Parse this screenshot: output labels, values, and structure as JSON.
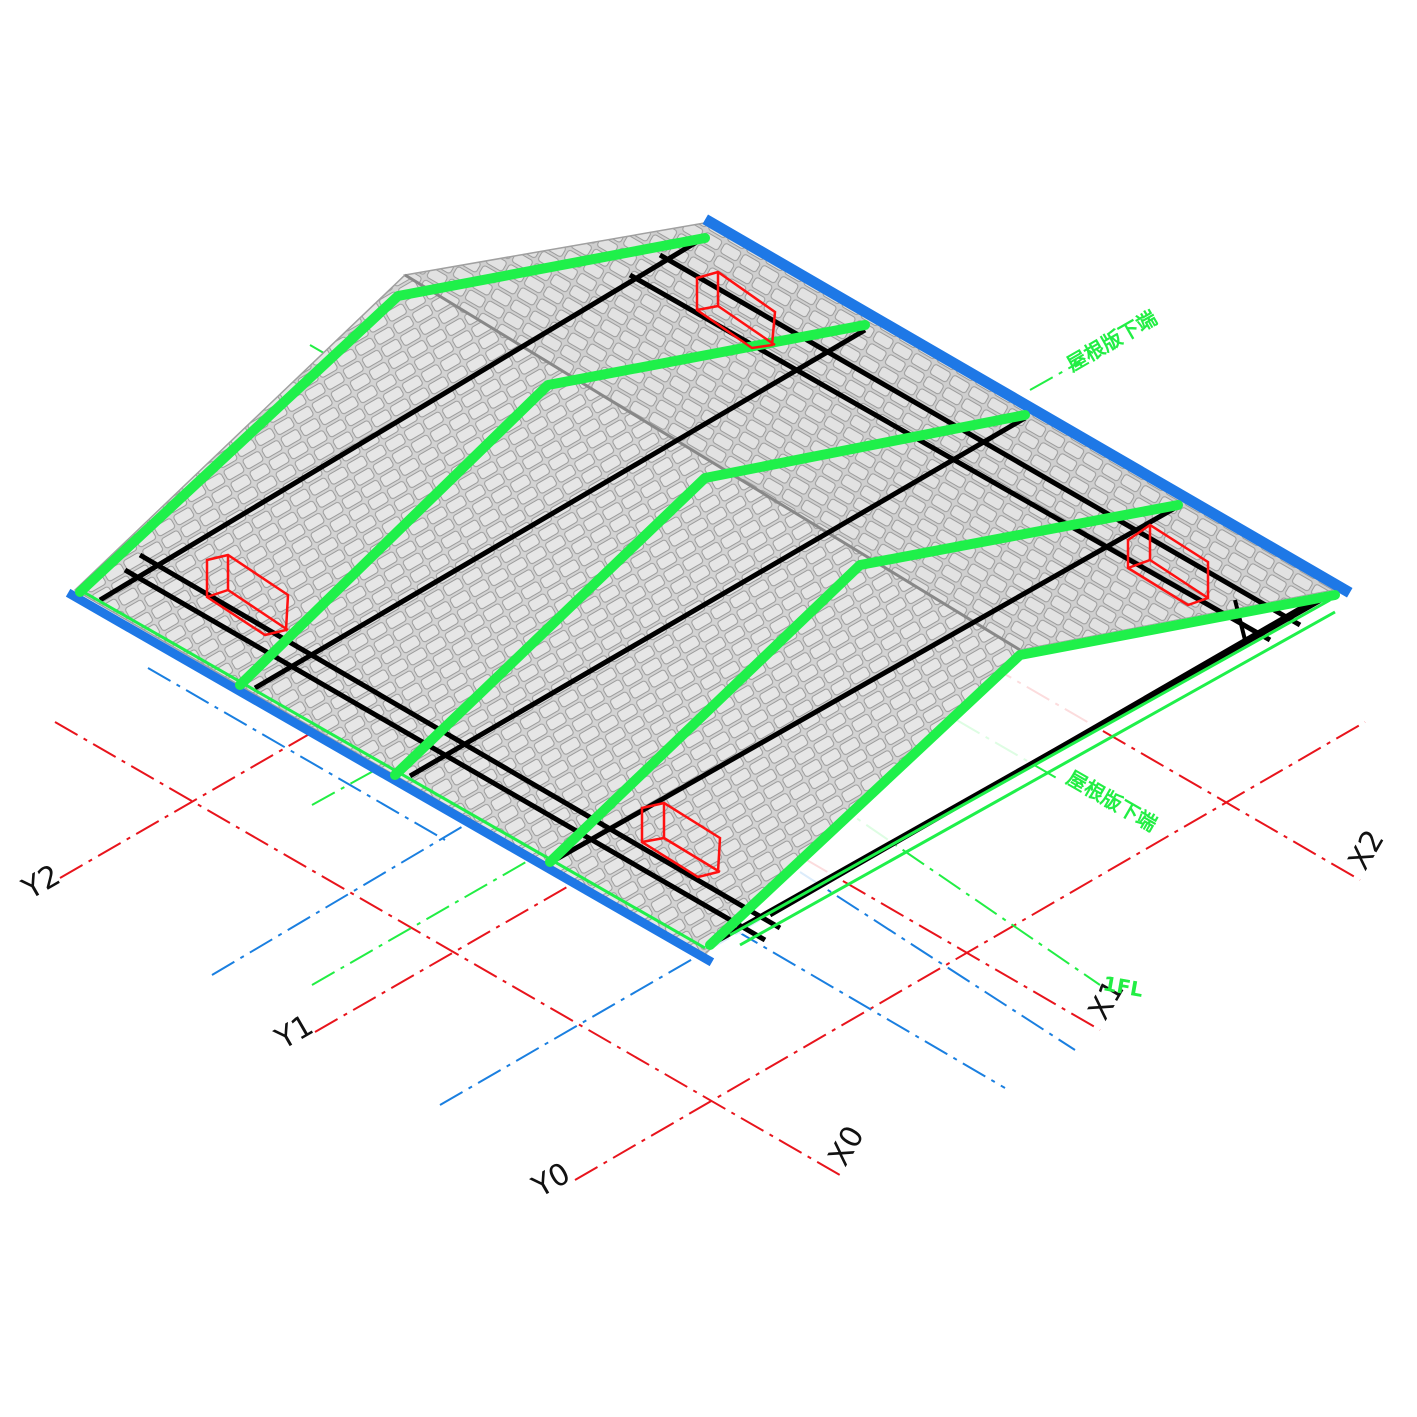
{
  "colors": {
    "grid_red": "#e8141c",
    "grid_blue": "#1a7fe0",
    "grid_green": "#22ee44",
    "rafter_green": "#1ff04a",
    "beam_black": "#000000",
    "tile_gray": "#a8a8a8",
    "tile_fill": "#c9c9c9",
    "eave_blue": "#1e78e6",
    "box_red": "#ff1010"
  },
  "grid_axes": {
    "x": [
      "X0",
      "X1",
      "X2"
    ],
    "y": [
      "Y0",
      "Y1",
      "Y2"
    ]
  },
  "level_labels": {
    "upper": "屋根版下端",
    "middle": "屋根版下端",
    "floor": "1FL"
  }
}
